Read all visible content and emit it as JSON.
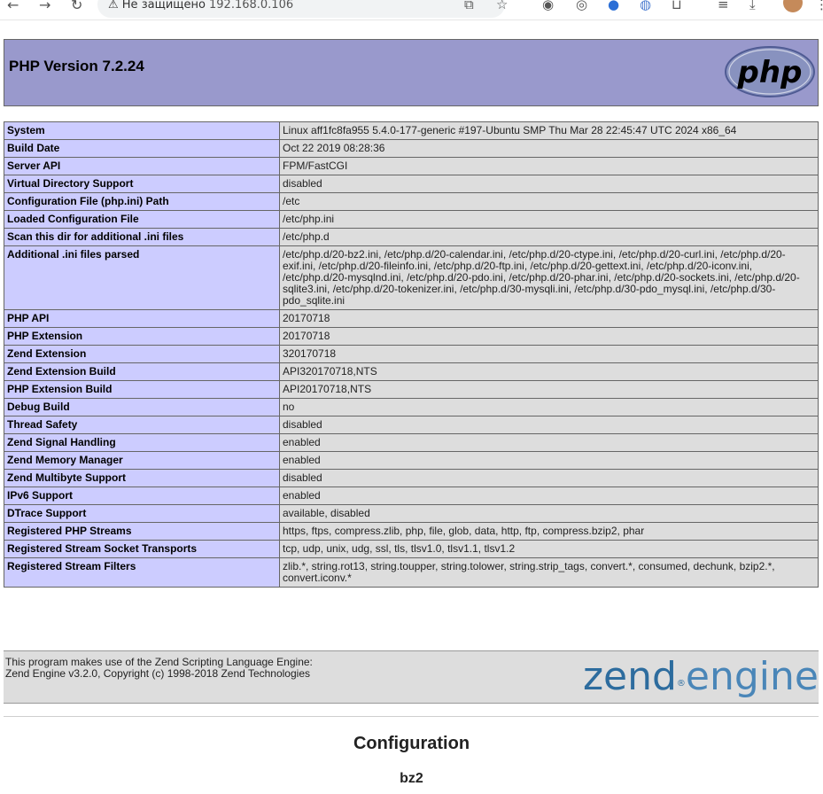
{
  "browser": {
    "security_warning": "⚠ Не защищено",
    "url": "192.168.0.106"
  },
  "header": {
    "title": "PHP Version 7.2.24",
    "logo_text": "php",
    "colors": {
      "header_bg": "#9999cc",
      "label_bg": "#ccccff",
      "value_bg": "#dddddd"
    }
  },
  "rows": [
    {
      "label": "System",
      "value": "Linux aff1fc8fa955 5.4.0-177-generic #197-Ubuntu SMP Thu Mar 28 22:45:47 UTC 2024 x86_64"
    },
    {
      "label": "Build Date",
      "value": "Oct 22 2019 08:28:36"
    },
    {
      "label": "Server API",
      "value": "FPM/FastCGI"
    },
    {
      "label": "Virtual Directory Support",
      "value": "disabled"
    },
    {
      "label": "Configuration File (php.ini) Path",
      "value": "/etc"
    },
    {
      "label": "Loaded Configuration File",
      "value": "/etc/php.ini"
    },
    {
      "label": "Scan this dir for additional .ini files",
      "value": "/etc/php.d"
    },
    {
      "label": "Additional .ini files parsed",
      "value": "/etc/php.d/20-bz2.ini, /etc/php.d/20-calendar.ini, /etc/php.d/20-ctype.ini, /etc/php.d/20-curl.ini, /etc/php.d/20-exif.ini, /etc/php.d/20-fileinfo.ini, /etc/php.d/20-ftp.ini, /etc/php.d/20-gettext.ini, /etc/php.d/20-iconv.ini, /etc/php.d/20-mysqlnd.ini, /etc/php.d/20-pdo.ini, /etc/php.d/20-phar.ini, /etc/php.d/20-sockets.ini, /etc/php.d/20-sqlite3.ini, /etc/php.d/20-tokenizer.ini, /etc/php.d/30-mysqli.ini, /etc/php.d/30-pdo_mysql.ini, /etc/php.d/30-pdo_sqlite.ini"
    },
    {
      "label": "PHP API",
      "value": "20170718"
    },
    {
      "label": "PHP Extension",
      "value": "20170718"
    },
    {
      "label": "Zend Extension",
      "value": "320170718"
    },
    {
      "label": "Zend Extension Build",
      "value": "API320170718,NTS"
    },
    {
      "label": "PHP Extension Build",
      "value": "API20170718,NTS"
    },
    {
      "label": "Debug Build",
      "value": "no"
    },
    {
      "label": "Thread Safety",
      "value": "disabled"
    },
    {
      "label": "Zend Signal Handling",
      "value": "enabled"
    },
    {
      "label": "Zend Memory Manager",
      "value": "enabled"
    },
    {
      "label": "Zend Multibyte Support",
      "value": "disabled"
    },
    {
      "label": "IPv6 Support",
      "value": "enabled"
    },
    {
      "label": "DTrace Support",
      "value": "available, disabled"
    },
    {
      "label": "Registered PHP Streams",
      "value": "https, ftps, compress.zlib, php, file, glob, data, http, ftp, compress.bzip2, phar"
    },
    {
      "label": "Registered Stream Socket Transports",
      "value": "tcp, udp, unix, udg, ssl, tls, tlsv1.0, tlsv1.1, tlsv1.2"
    },
    {
      "label": "Registered Stream Filters",
      "value": "zlib.*, string.rot13, string.toupper, string.tolower, string.strip_tags, convert.*, consumed, dechunk, bzip2.*, convert.iconv.*"
    }
  ],
  "zend": {
    "line1": "This program makes use of the Zend Scripting Language Engine:",
    "line2": "Zend Engine v3.2.0, Copyright (c) 1998-2018 Zend Technologies",
    "logo_part1": "zend",
    "logo_part2": "engine",
    "logo_mark": "®"
  },
  "sections": {
    "configuration": "Configuration",
    "first_module": "bz2"
  }
}
